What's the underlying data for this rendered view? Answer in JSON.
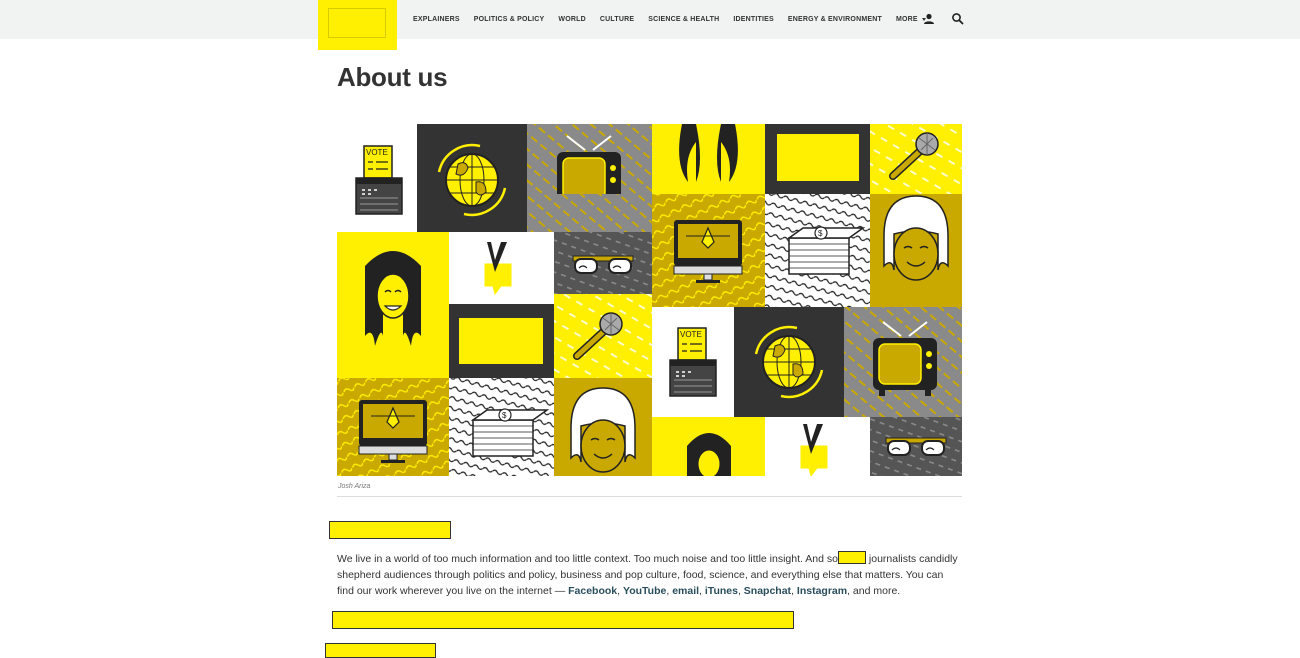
{
  "nav": {
    "items": [
      "EXPLAINERS",
      "POLITICS & POLICY",
      "WORLD",
      "CULTURE",
      "SCIENCE & HEALTH",
      "IDENTITIES",
      "ENERGY & ENVIRONMENT"
    ],
    "more_label": "MORE",
    "icons": [
      "user-icon",
      "search-icon"
    ]
  },
  "page": {
    "title": "About us",
    "image_credit": "Josh Ariza"
  },
  "intro": {
    "text_1": "We live in a world of too much information and too little context. Too much noise and too little insight. And so",
    "text_2": " journalists candidly shepherd audiences through politics and policy, business and pop culture, food, science, and everything else that matters. You can find our work wherever you live on the internet — ",
    "links": [
      "Facebook",
      "YouTube",
      "email",
      "iTunes",
      "Snapchat",
      "Instagram"
    ],
    "separators": [
      ", ",
      ", ",
      ", ",
      ", ",
      ", "
    ],
    "closing": ", and more."
  },
  "colors": {
    "accent": "#ffef00",
    "topbar": "#f1f2f2",
    "text": "#333333",
    "link": "#2a4d5c",
    "tile_dark": "#333333",
    "tile_mustard": "#c9a800"
  }
}
